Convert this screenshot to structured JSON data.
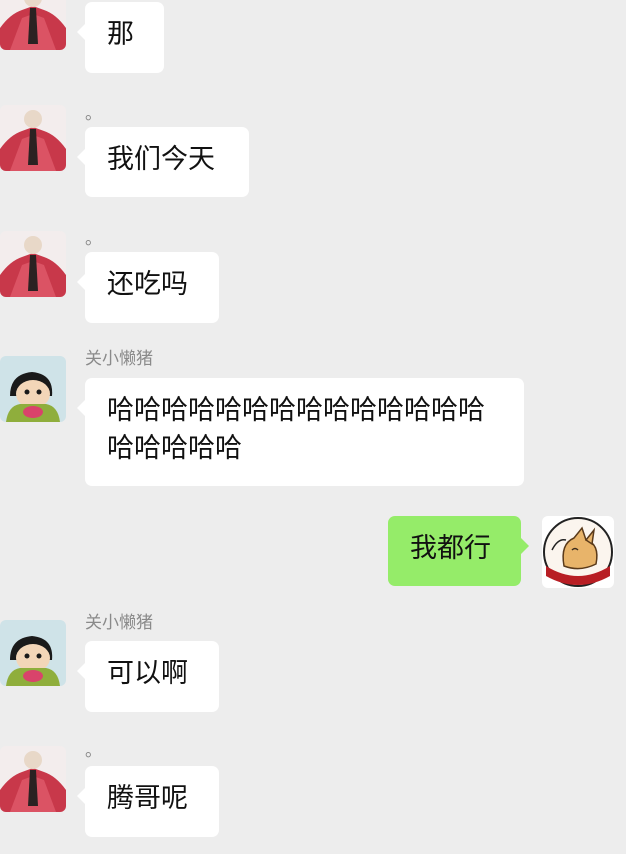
{
  "messages": [
    {
      "side": "left",
      "avatar": "robed-figure-avatar",
      "sender": "",
      "text": "那"
    },
    {
      "side": "left",
      "avatar": "robed-figure-avatar",
      "sender": "。",
      "text": "我们今天"
    },
    {
      "side": "left",
      "avatar": "robed-figure-avatar",
      "sender": "。",
      "text": "还吃吗"
    },
    {
      "side": "left",
      "avatar": "cartoon-boy-avatar",
      "sender": "关小懒猪",
      "text": "哈哈哈哈哈哈哈哈哈哈哈哈哈哈哈哈哈哈哈"
    },
    {
      "side": "right",
      "avatar": "cat-avatar",
      "sender": "",
      "text": "我都行"
    },
    {
      "side": "left",
      "avatar": "cartoon-boy-avatar",
      "sender": "关小懒猪",
      "text": "可以啊"
    },
    {
      "side": "left",
      "avatar": "robed-figure-avatar",
      "sender": "。",
      "text": "腾哥呢"
    }
  ],
  "colors": {
    "background": "#ededed",
    "incoming_bubble": "#ffffff",
    "outgoing_bubble": "#95ec69",
    "sender_name": "#8a8a8a"
  }
}
